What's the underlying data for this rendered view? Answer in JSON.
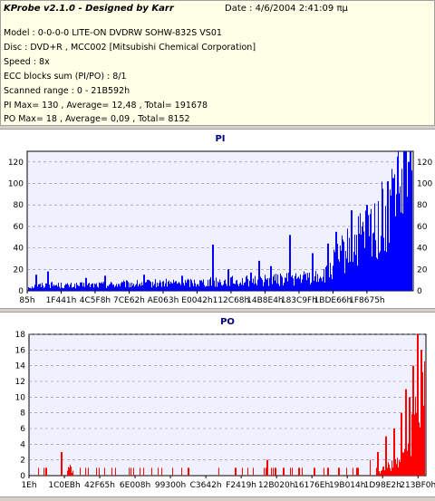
{
  "header": {
    "title": "KProbe v2.1.0 - Designed by Karr",
    "date": "Date : 4/6/2004 2:41:09 πμ",
    "lines": [
      "Model : 0-0-0-0 LITE-ON DVDRW SOHW-832S  VS01",
      "Disc : DVD+R , MCC002 [Mitsubishi Chemical Corporation]",
      "Speed : 8x",
      "ECC blocks sum (PI/PO) : 8/1",
      "Scanned range : 0 - 21B592h",
      "PI Max= 130 , Average= 12,48 , Total= 191678",
      "PO Max= 18 , Average= 0,09 , Total= 8152"
    ]
  },
  "chart_data": [
    {
      "type": "bar",
      "title": "PI",
      "color": "#0000ff",
      "ylim": [
        0,
        130
      ],
      "yticks": [
        0,
        20,
        40,
        60,
        80,
        100,
        120
      ],
      "show_right_axis": true,
      "xtick_labels": [
        "85h",
        "1F441h",
        "4C5F8h",
        "7CE62h",
        "AE063h",
        "E0042h",
        "112C68h",
        "14B8E4h",
        "183C9Fh",
        "1BDE66h",
        "1F8675h"
      ],
      "grid": true,
      "baseline_shape": [
        [
          0,
          4
        ],
        [
          0.05,
          6
        ],
        [
          0.1,
          5
        ],
        [
          0.2,
          6
        ],
        [
          0.3,
          7
        ],
        [
          0.4,
          8
        ],
        [
          0.5,
          9
        ],
        [
          0.6,
          10
        ],
        [
          0.7,
          12
        ],
        [
          0.78,
          16
        ],
        [
          0.8,
          30
        ],
        [
          0.85,
          45
        ],
        [
          0.9,
          60
        ],
        [
          0.95,
          80
        ],
        [
          0.98,
          100
        ],
        [
          1,
          110
        ]
      ],
      "spikes": [
        [
          0.02,
          15
        ],
        [
          0.05,
          18
        ],
        [
          0.15,
          12
        ],
        [
          0.2,
          14
        ],
        [
          0.3,
          15
        ],
        [
          0.4,
          14
        ],
        [
          0.48,
          43
        ],
        [
          0.52,
          20
        ],
        [
          0.58,
          17
        ],
        [
          0.6,
          28
        ],
        [
          0.63,
          23
        ],
        [
          0.68,
          52
        ],
        [
          0.74,
          35
        ],
        [
          0.78,
          44
        ],
        [
          0.8,
          55
        ],
        [
          0.84,
          75
        ],
        [
          0.88,
          80
        ],
        [
          0.92,
          95
        ],
        [
          0.95,
          105
        ],
        [
          0.96,
          125
        ],
        [
          0.98,
          130
        ],
        [
          0.99,
          120
        ]
      ]
    },
    {
      "type": "bar",
      "title": "PO",
      "color": "#ff0000",
      "ylim": [
        0,
        18
      ],
      "yticks": [
        0,
        2,
        4,
        6,
        8,
        10,
        12,
        14,
        16,
        18
      ],
      "show_right_axis": false,
      "xtick_labels": [
        "1Eh",
        "1C0EBh",
        "42F65h",
        "6E008h",
        "99300h",
        "C3642h",
        "F2419h",
        "12B020h",
        "16176Eh",
        "19B014h",
        "1D98E2h",
        "213BF0h"
      ],
      "grid": true,
      "baseline_shape": [
        [
          0,
          0
        ],
        [
          0.08,
          0
        ],
        [
          0.1,
          1
        ],
        [
          0.12,
          0
        ],
        [
          0.4,
          0
        ],
        [
          0.6,
          0
        ],
        [
          0.85,
          0
        ],
        [
          0.9,
          1
        ],
        [
          0.93,
          2
        ],
        [
          0.96,
          5
        ],
        [
          0.98,
          8
        ],
        [
          1,
          10
        ]
      ],
      "spikes": [
        [
          0.04,
          1
        ],
        [
          0.08,
          3
        ],
        [
          0.1,
          1
        ],
        [
          0.14,
          1
        ],
        [
          0.25,
          1
        ],
        [
          0.4,
          1
        ],
        [
          0.52,
          1
        ],
        [
          0.6,
          2
        ],
        [
          0.62,
          1
        ],
        [
          0.68,
          1
        ],
        [
          0.72,
          1
        ],
        [
          0.78,
          1
        ],
        [
          0.83,
          1
        ],
        [
          0.86,
          2
        ],
        [
          0.88,
          3
        ],
        [
          0.9,
          5
        ],
        [
          0.92,
          6
        ],
        [
          0.94,
          8
        ],
        [
          0.95,
          11
        ],
        [
          0.96,
          10
        ],
        [
          0.97,
          14
        ],
        [
          0.98,
          18
        ],
        [
          0.99,
          16
        ]
      ]
    }
  ]
}
